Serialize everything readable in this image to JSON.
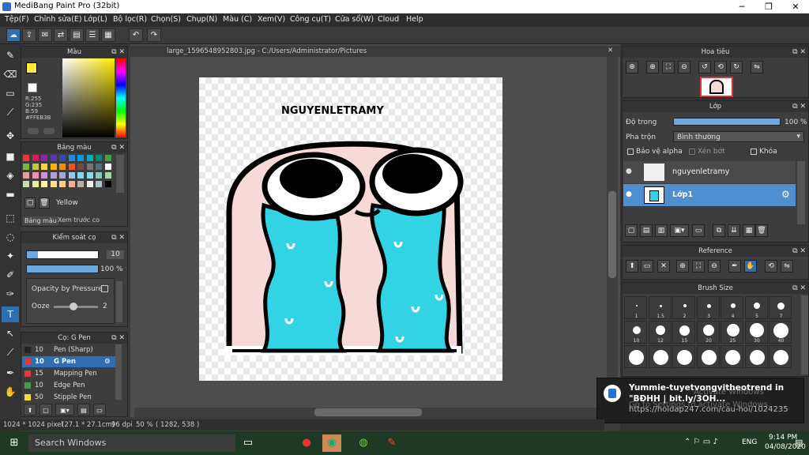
{
  "window": {
    "title": "MediBang Paint Pro (32bit)",
    "minimize": "─",
    "maximize": "❐",
    "close": "✕"
  },
  "menu": [
    "Tệp(F)",
    "Chỉnh sửa(E)",
    "Lớp(L)",
    "Bộ lọc(R)",
    "Chọn(S)",
    "Chụp(N)",
    "Màu (C)",
    "Xem(V)",
    "Công cụ(T)",
    "Cửa sổ(W)",
    "Cloud",
    "Help"
  ],
  "document": {
    "tab": "large_1596548952803.jpg - C:/Users/Administrator/Pictures",
    "canvas_text": "NGUYENLETRAMY"
  },
  "color_panel": {
    "title": "Màu",
    "r": "R:255",
    "g": "G:235",
    "b": "B:59",
    "hex": "#FFEB3B",
    "fg": "#FFEB3B",
    "bg": "#3d8fd1"
  },
  "palette_panel": {
    "title": "Bảng màu",
    "selected_name": "Yellow",
    "tab1": "Bảng màu",
    "tab2": "Xem trước co",
    "colors": [
      "#e53935",
      "#d81b60",
      "#8e24aa",
      "#5e35b1",
      "#3949ab",
      "#1e88e5",
      "#039be5",
      "#00acc1",
      "#00897b",
      "#43a047",
      "#7cb342",
      "#c0ca33",
      "#fdd835",
      "#ffb300",
      "#fb8c00",
      "#f4511e",
      "#6d4c41",
      "#757575",
      "#546e7a",
      "#ffffff",
      "#ef9a9a",
      "#f48fb1",
      "#ce93d8",
      "#b39ddb",
      "#9fa8da",
      "#90caf9",
      "#81d4fa",
      "#80deea",
      "#80cbc4",
      "#a5d6a7",
      "#c5e1a5",
      "#e6ee9c",
      "#fff59d",
      "#ffe082",
      "#ffcc80",
      "#ffab91",
      "#bcaaa4",
      "#eeeeee",
      "#b0bec5",
      "#000000"
    ]
  },
  "brush_control": {
    "title": "Kiểm soát cọ",
    "size_value": "10",
    "opacity_value": "100 %",
    "size_fraction": 0.15,
    "opacity_fraction": 1.0,
    "opacity_pressure_label": "Opacity by Pressure",
    "ooze_label": "Ooze",
    "ooze_value": "2",
    "ooze_fraction": 0.45
  },
  "brush_list": {
    "title": "Cọ: G Pen",
    "items": [
      {
        "size": "10",
        "name": "Pen (Sharp)",
        "color": "#222222",
        "selected": false
      },
      {
        "size": "10",
        "name": "G Pen",
        "color": "#e53935",
        "selected": true
      },
      {
        "size": "15",
        "name": "Mapping Pen",
        "color": "#e53935",
        "selected": false
      },
      {
        "size": "10",
        "name": "Edge Pen",
        "color": "#43a047",
        "selected": false
      },
      {
        "size": "50",
        "name": "Stipple Pen",
        "color": "#fdd835",
        "selected": false
      }
    ]
  },
  "navigator": {
    "title": "Hoa tiêu"
  },
  "layers": {
    "title": "Lớp",
    "opacity_label": "Độ trong",
    "opacity_value": "100 %",
    "opacity_fraction": 1.0,
    "blend_label": "Pha trộn",
    "blend_value": "Bình thường",
    "protect_alpha": "Bảo vệ alpha",
    "clipping": "Xén bớt",
    "lock": "Khóa",
    "items": [
      {
        "name": "nguyenletramy",
        "selected": false
      },
      {
        "name": "Lớp1",
        "selected": true
      }
    ]
  },
  "reference": {
    "title": "Reference"
  },
  "brush_size": {
    "title": "Brush Size",
    "labels": [
      "1",
      "1.5",
      "2",
      "3",
      "4",
      "5",
      "7",
      "10",
      "12",
      "15",
      "20",
      "25",
      "30",
      "40"
    ]
  },
  "status": {
    "size": "1024 * 1024 pixel",
    "cm": "(27.1 * 27.1cm)",
    "dpi": "96 dpi",
    "zoom": "50 %",
    "coords": "( 1282, 538 )"
  },
  "taskbar": {
    "search": "Search Windows",
    "time": "9:14 PM",
    "date": "04/08/2020",
    "lang": "ENG"
  },
  "notification": {
    "title": "Yummie-tuyetvongvitheotrend in",
    "line2": "\"BĐHH | bit.ly/3OH...",
    "url": "https://hoidap247.com/cau-hoi/1024235",
    "activate1": "Activate Windows",
    "activate2": "Go to Settings to activate Windows."
  }
}
